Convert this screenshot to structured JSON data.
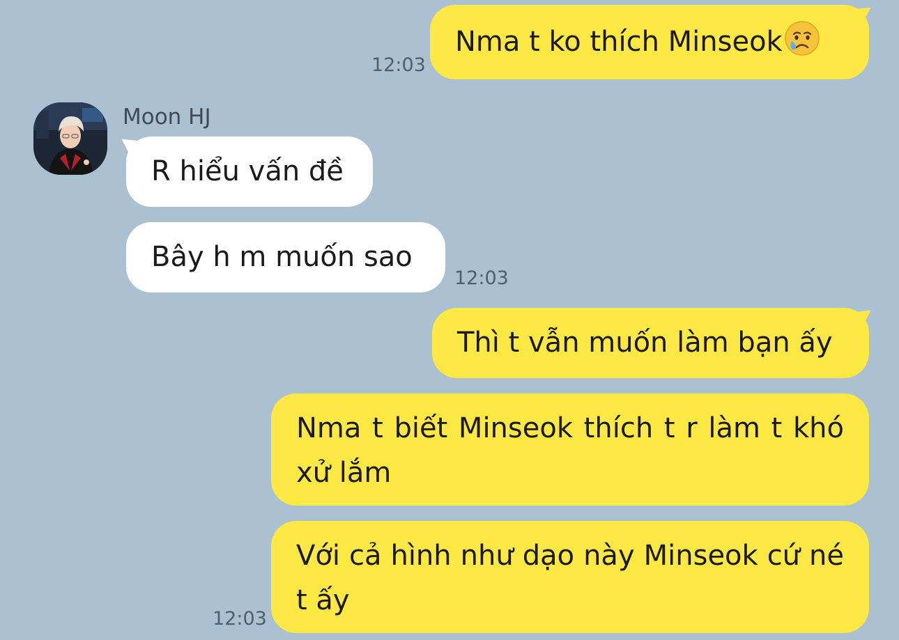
{
  "messages": {
    "m1": {
      "text": "Nma t ko thích Minseok",
      "emoji": "crying-face-icon",
      "time": "12:03"
    },
    "sender": {
      "name": "Moon HJ"
    },
    "m2": {
      "text": "R hiểu vấn đề"
    },
    "m3": {
      "text": "Bây h m muốn sao",
      "time": "12:03"
    },
    "m4": {
      "text": "Thì t vẫn muốn làm bạn ấy"
    },
    "m5": {
      "text": "Nma t biết Minseok thích t r làm t khó xử lắm"
    },
    "m6": {
      "text": "Với cả hình như dạo này Minseok cứ né t ấy",
      "time": "12:03"
    }
  },
  "colors": {
    "background": "#abc1d1",
    "outgoing_bubble": "#fee843",
    "incoming_bubble": "#ffffff",
    "timestamp": "#4f5e69"
  }
}
